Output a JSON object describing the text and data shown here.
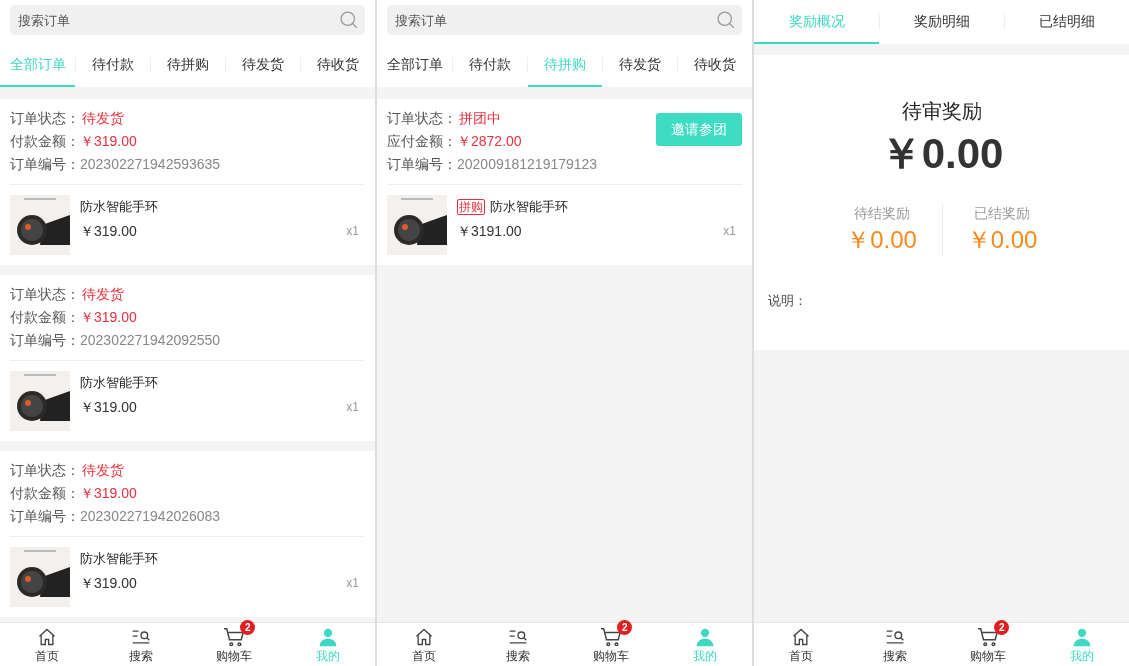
{
  "screens": [
    {
      "kind": "orders",
      "search": {
        "placeholder": "搜索订单"
      },
      "tabs": [
        {
          "label": "全部订单",
          "selected": true
        },
        {
          "label": "待付款",
          "selected": false
        },
        {
          "label": "待拼购",
          "selected": false
        },
        {
          "label": "待发货",
          "selected": false
        },
        {
          "label": "待收货",
          "selected": false
        }
      ],
      "orders": [
        {
          "status_label": "订单状态：",
          "status": "待发货",
          "amount_label": "付款金额：",
          "amount": "￥319.00",
          "number_label": "订单编号：",
          "number": "202302271942593635",
          "items": [
            {
              "name": "防水智能手环",
              "price": "￥319.00",
              "quantity": "x1"
            }
          ]
        },
        {
          "status_label": "订单状态：",
          "status": "待发货",
          "amount_label": "付款金额：",
          "amount": "￥319.00",
          "number_label": "订单编号：",
          "number": "202302271942092550",
          "items": [
            {
              "name": "防水智能手环",
              "price": "￥319.00",
              "quantity": "x1"
            }
          ]
        },
        {
          "status_label": "订单状态：",
          "status": "待发货",
          "amount_label": "付款金额：",
          "amount": "￥319.00",
          "number_label": "订单编号：",
          "number": "202302271942026083",
          "items": [
            {
              "name": "防水智能手环",
              "price": "￥319.00",
              "quantity": "x1"
            }
          ]
        }
      ],
      "nav": [
        {
          "label": "首页",
          "kind": "home",
          "selected": false
        },
        {
          "label": "搜索",
          "kind": "search",
          "selected": false
        },
        {
          "label": "购物车",
          "kind": "cart",
          "selected": false,
          "badge": "2"
        },
        {
          "label": "我的",
          "kind": "user",
          "selected": true
        }
      ]
    },
    {
      "kind": "orders",
      "search": {
        "placeholder": "搜索订单"
      },
      "tabs": [
        {
          "label": "全部订单",
          "selected": false
        },
        {
          "label": "待付款",
          "selected": false
        },
        {
          "label": "待拼购",
          "selected": true
        },
        {
          "label": "待发货",
          "selected": false
        },
        {
          "label": "待收货",
          "selected": false
        }
      ],
      "orders": [
        {
          "status_label": "订单状态：",
          "status": "拼团中",
          "amount_label": "应付金额：",
          "amount": "￥2872.00",
          "number_label": "订单编号：",
          "number": "202009181219179123",
          "action": "邀请参团",
          "items": [
            {
              "tag": "拼购",
              "name": "防水智能手环",
              "price": "￥3191.00",
              "quantity": "x1"
            }
          ]
        }
      ],
      "nav": [
        {
          "label": "首页",
          "kind": "home",
          "selected": false
        },
        {
          "label": "搜索",
          "kind": "search",
          "selected": false
        },
        {
          "label": "购物车",
          "kind": "cart",
          "selected": false,
          "badge": "2"
        },
        {
          "label": "我的",
          "kind": "user",
          "selected": true
        }
      ]
    },
    {
      "kind": "reward",
      "tabs": [
        {
          "label": "奖励概况",
          "selected": true
        },
        {
          "label": "奖励明细",
          "selected": false
        },
        {
          "label": "已结明细",
          "selected": false
        }
      ],
      "title": "待审奖励",
      "total": "￥0.00",
      "stats": [
        {
          "label": "待结奖励",
          "value": "￥0.00"
        },
        {
          "label": "已结奖励",
          "value": "￥0.00"
        }
      ],
      "note_label": "说明：",
      "nav": [
        {
          "label": "首页",
          "kind": "home",
          "selected": false
        },
        {
          "label": "搜索",
          "kind": "search",
          "selected": false
        },
        {
          "label": "购物车",
          "kind": "cart",
          "selected": false,
          "badge": "2"
        },
        {
          "label": "我的",
          "kind": "user",
          "selected": true
        }
      ]
    }
  ]
}
